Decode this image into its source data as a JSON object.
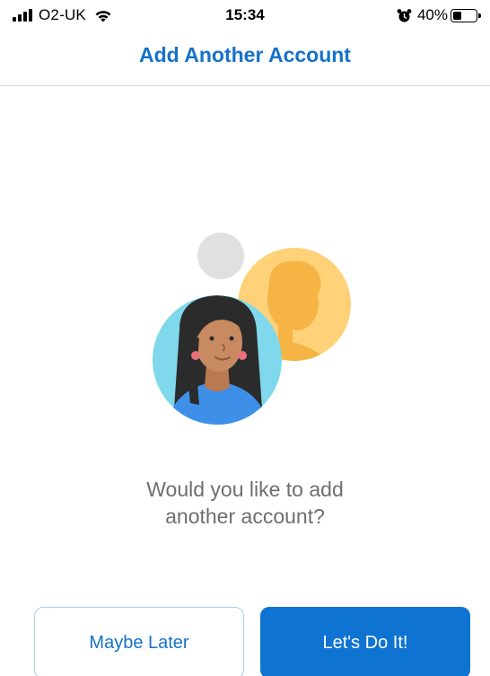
{
  "status_bar": {
    "carrier": "O2-UK",
    "time": "15:34",
    "battery_percent_label": "40%",
    "battery_level": 0.4,
    "icons": [
      "signal-icon",
      "wifi-icon",
      "alarm-icon",
      "battery-icon"
    ]
  },
  "header": {
    "title": "Add Another Account"
  },
  "illustration": {
    "description_icons": [
      "person-avatar-woman",
      "person-silhouette"
    ],
    "colors": {
      "accent_blue": "#0f73d2",
      "avatar_bg": "#7fd8ec",
      "silhouette_bg": "#ffd27a",
      "silhouette_fg": "#f6b445",
      "grey_dot": "#e0e0e0"
    }
  },
  "prompt": {
    "line1": "Would you like to add",
    "line2": "another account?"
  },
  "buttons": {
    "maybe_later": "Maybe Later",
    "lets_do_it": "Let's Do It!"
  }
}
